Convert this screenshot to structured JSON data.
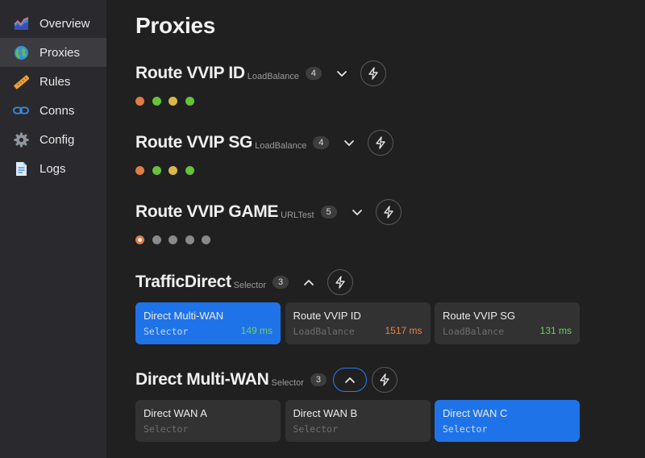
{
  "nav": [
    {
      "label": "Overview",
      "icon": "chart-area-icon",
      "active": false
    },
    {
      "label": "Proxies",
      "icon": "globe-icon",
      "active": true
    },
    {
      "label": "Rules",
      "icon": "ruler-icon",
      "active": false
    },
    {
      "label": "Conns",
      "icon": "link-icon",
      "active": false
    },
    {
      "label": "Config",
      "icon": "gear-icon",
      "active": false
    },
    {
      "label": "Logs",
      "icon": "document-icon",
      "active": false
    }
  ],
  "page_title": "Proxies",
  "groups": [
    {
      "name": "Route VVIP ID",
      "type": "LoadBalance",
      "count": "4",
      "expanded": false,
      "dots": [
        {
          "color": "#e07d43"
        },
        {
          "color": "#66c23a"
        },
        {
          "color": "#d9b84a"
        },
        {
          "color": "#66c23a"
        }
      ]
    },
    {
      "name": "Route VVIP SG",
      "type": "LoadBalance",
      "count": "4",
      "expanded": false,
      "dots": [
        {
          "color": "#e07d43"
        },
        {
          "color": "#66c23a"
        },
        {
          "color": "#d9b84a"
        },
        {
          "color": "#66c23a"
        }
      ]
    },
    {
      "name": "Route VVIP GAME",
      "type": "URLTest",
      "count": "5",
      "expanded": false,
      "dots": [
        {
          "color": "#e07d43",
          "ring": true
        },
        {
          "color": "#8a8a8a"
        },
        {
          "color": "#8a8a8a"
        },
        {
          "color": "#8a8a8a"
        },
        {
          "color": "#8a8a8a"
        }
      ]
    },
    {
      "name": "TrafficDirect",
      "type": "Selector",
      "count": "3",
      "expanded": true,
      "cards": [
        {
          "name": "Direct Multi-WAN",
          "type": "Selector",
          "latency": "149 ms",
          "latency_color": "#6fd15a",
          "selected": true
        },
        {
          "name": "Route VVIP ID",
          "type": "LoadBalance",
          "latency": "1517 ms",
          "latency_color": "#e8843e",
          "selected": false
        },
        {
          "name": "Route VVIP SG",
          "type": "LoadBalance",
          "latency": "131 ms",
          "latency_color": "#6fd15a",
          "selected": false
        }
      ]
    },
    {
      "name": "Direct Multi-WAN",
      "type": "Selector",
      "count": "3",
      "expanded": true,
      "toggle_focused": true,
      "cards": [
        {
          "name": "Direct WAN A",
          "type": "Selector",
          "latency": "",
          "selected": false
        },
        {
          "name": "Direct WAN B",
          "type": "Selector",
          "latency": "",
          "selected": false
        },
        {
          "name": "Direct WAN C",
          "type": "Selector",
          "latency": "",
          "selected": true
        }
      ]
    }
  ]
}
